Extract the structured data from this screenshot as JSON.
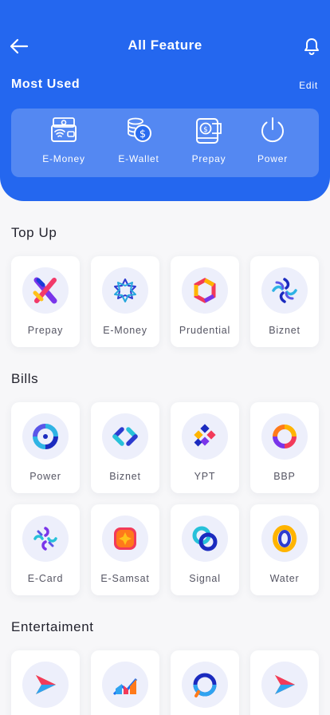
{
  "header": {
    "title": "All Feature",
    "back_icon": "arrow-left-icon",
    "notification_icon": "bell-icon",
    "background": "#2467ef"
  },
  "most_used": {
    "title": "Most Used",
    "edit_label": "Edit",
    "items": [
      {
        "label": "E-Money",
        "icon": "card-wallet-icon"
      },
      {
        "label": "E-Wallet",
        "icon": "coins-dollar-icon"
      },
      {
        "label": "Prepay",
        "icon": "phone-cash-icon"
      },
      {
        "label": "Power",
        "icon": "power-icon"
      }
    ]
  },
  "sections": [
    {
      "title": "Top Up",
      "items": [
        {
          "label": "Prepay",
          "icon": "prepay-logo-icon"
        },
        {
          "label": "E-Money",
          "icon": "emoney-logo-icon"
        },
        {
          "label": "Prudential",
          "icon": "prudential-logo-icon"
        },
        {
          "label": "Biznet",
          "icon": "biznet-logo-icon"
        }
      ]
    },
    {
      "title": "Bills",
      "items": [
        {
          "label": "Power",
          "icon": "power-logo-icon"
        },
        {
          "label": "Biznet",
          "icon": "biznet-bills-logo-icon"
        },
        {
          "label": "YPT",
          "icon": "ypt-logo-icon"
        },
        {
          "label": "BBP",
          "icon": "bbp-logo-icon"
        },
        {
          "label": "E-Card",
          "icon": "ecard-logo-icon"
        },
        {
          "label": "E-Samsat",
          "icon": "esamsat-logo-icon"
        },
        {
          "label": "Signal",
          "icon": "signal-logo-icon"
        },
        {
          "label": "Water",
          "icon": "water-logo-icon"
        }
      ]
    },
    {
      "title": "Entertaiment",
      "items": [
        {
          "label": "",
          "icon": "play-arrow-logo-icon"
        },
        {
          "label": "",
          "icon": "chart-bars-logo-icon"
        },
        {
          "label": "",
          "icon": "ring-logo-icon"
        },
        {
          "label": "",
          "icon": "play-arrow-logo-icon"
        }
      ]
    }
  ]
}
